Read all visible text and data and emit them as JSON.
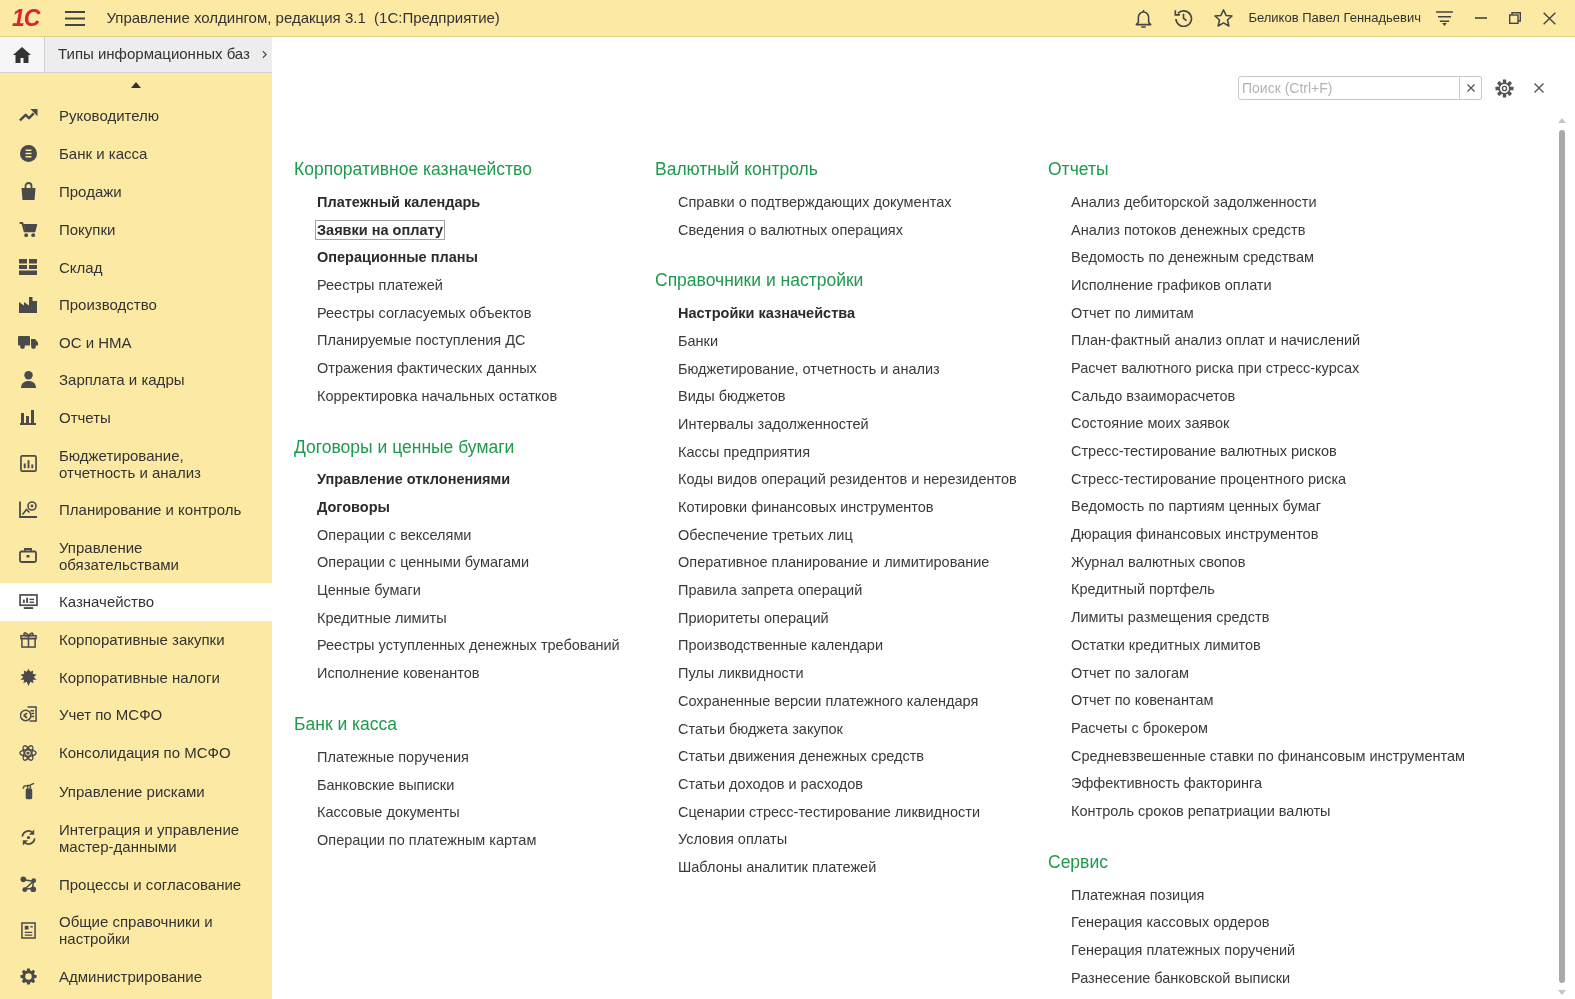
{
  "window": {
    "logo": "1С",
    "title": "Управление холдингом, редакция 3.1  (1С:Предприятие)",
    "user": "Беликов Павел Геннадьевич"
  },
  "tabs": [
    {
      "label": "Типы информационных баз"
    }
  ],
  "sidebar": {
    "items": [
      {
        "label": "Руководителю",
        "selected": false
      },
      {
        "label": "Банк и касса",
        "selected": false
      },
      {
        "label": "Продажи",
        "selected": false
      },
      {
        "label": "Покупки",
        "selected": false
      },
      {
        "label": "Склад",
        "selected": false
      },
      {
        "label": "Производство",
        "selected": false
      },
      {
        "label": "ОС и НМА",
        "selected": false
      },
      {
        "label": "Зарплата и кадры",
        "selected": false
      },
      {
        "label": "Отчеты",
        "selected": false
      },
      {
        "label": "Бюджетирование, отчетность и анализ",
        "selected": false
      },
      {
        "label": "Планирование и контроль",
        "selected": false
      },
      {
        "label": "Управление обязательствами",
        "selected": false
      },
      {
        "label": "Казначейство",
        "selected": true
      },
      {
        "label": "Корпоративные закупки",
        "selected": false
      },
      {
        "label": "Корпоративные налоги",
        "selected": false
      },
      {
        "label": "Учет по МСФО",
        "selected": false
      },
      {
        "label": "Консолидация по МСФО",
        "selected": false
      },
      {
        "label": "Управление рисками",
        "selected": false
      },
      {
        "label": "Интеграция и управление мастер-данными",
        "selected": false
      },
      {
        "label": "Процессы и согласование",
        "selected": false
      },
      {
        "label": "Общие справочники и настройки",
        "selected": false
      },
      {
        "label": "Администрирование",
        "selected": false
      }
    ]
  },
  "search": {
    "placeholder": "Поиск (Ctrl+F)"
  },
  "columns": [
    {
      "sections": [
        {
          "title": "Корпоративное казначейство",
          "items": [
            {
              "label": "Платежный календарь",
              "bold": true,
              "focused": false
            },
            {
              "label": "Заявки на оплату",
              "bold": true,
              "focused": true
            },
            {
              "label": "Операционные планы",
              "bold": true,
              "focused": false
            },
            {
              "label": "Реестры платежей",
              "bold": false,
              "focused": false
            },
            {
              "label": "Реестры согласуемых объектов",
              "bold": false,
              "focused": false
            },
            {
              "label": "Планируемые поступления ДС",
              "bold": false,
              "focused": false
            },
            {
              "label": "Отражения фактических данных",
              "bold": false,
              "focused": false
            },
            {
              "label": "Корректировка начальных остатков",
              "bold": false,
              "focused": false
            }
          ]
        },
        {
          "title": "Договоры и ценные бумаги",
          "items": [
            {
              "label": "Управление отклонениями",
              "bold": true,
              "focused": false
            },
            {
              "label": "Договоры",
              "bold": true,
              "focused": false
            },
            {
              "label": "Операции с векселями",
              "bold": false,
              "focused": false
            },
            {
              "label": "Операции с ценными бумагами",
              "bold": false,
              "focused": false
            },
            {
              "label": "Ценные бумаги",
              "bold": false,
              "focused": false
            },
            {
              "label": "Кредитные лимиты",
              "bold": false,
              "focused": false
            },
            {
              "label": "Реестры уступленных денежных требований",
              "bold": false,
              "focused": false
            },
            {
              "label": "Исполнение ковенантов",
              "bold": false,
              "focused": false
            }
          ]
        },
        {
          "title": "Банк и касса",
          "items": [
            {
              "label": "Платежные поручения",
              "bold": false,
              "focused": false
            },
            {
              "label": "Банковские выписки",
              "bold": false,
              "focused": false
            },
            {
              "label": "Кассовые документы",
              "bold": false,
              "focused": false
            },
            {
              "label": "Операции по платежным картам",
              "bold": false,
              "focused": false
            }
          ]
        }
      ]
    },
    {
      "sections": [
        {
          "title": "Валютный контроль",
          "items": [
            {
              "label": "Справки о подтверждающих документах",
              "bold": false,
              "focused": false
            },
            {
              "label": "Сведения о валютных операциях",
              "bold": false,
              "focused": false
            }
          ]
        },
        {
          "title": "Справочники и настройки",
          "items": [
            {
              "label": "Настройки казначейства",
              "bold": true,
              "focused": false
            },
            {
              "label": "Банки",
              "bold": false,
              "focused": false
            },
            {
              "label": "Бюджетирование, отчетность и анализ",
              "bold": false,
              "focused": false
            },
            {
              "label": "Виды бюджетов",
              "bold": false,
              "focused": false
            },
            {
              "label": "Интервалы задолженностей",
              "bold": false,
              "focused": false
            },
            {
              "label": "Кассы предприятия",
              "bold": false,
              "focused": false
            },
            {
              "label": "Коды видов операций резидентов и нерезидентов",
              "bold": false,
              "focused": false
            },
            {
              "label": "Котировки финансовых инструментов",
              "bold": false,
              "focused": false
            },
            {
              "label": "Обеспечение третьих лиц",
              "bold": false,
              "focused": false
            },
            {
              "label": "Оперативное планирование и лимитирование",
              "bold": false,
              "focused": false
            },
            {
              "label": "Правила запрета операций",
              "bold": false,
              "focused": false
            },
            {
              "label": "Приоритеты операций",
              "bold": false,
              "focused": false
            },
            {
              "label": "Производственные календари",
              "bold": false,
              "focused": false
            },
            {
              "label": "Пулы ликвидности",
              "bold": false,
              "focused": false
            },
            {
              "label": "Сохраненные версии платежного календаря",
              "bold": false,
              "focused": false
            },
            {
              "label": "Статьи бюджета закупок",
              "bold": false,
              "focused": false
            },
            {
              "label": "Статьи движения денежных средств",
              "bold": false,
              "focused": false
            },
            {
              "label": "Статьи доходов и расходов",
              "bold": false,
              "focused": false
            },
            {
              "label": "Сценарии стресс-тестирование ликвидности",
              "bold": false,
              "focused": false
            },
            {
              "label": "Условия оплаты",
              "bold": false,
              "focused": false
            },
            {
              "label": "Шаблоны аналитик платежей",
              "bold": false,
              "focused": false
            }
          ]
        }
      ]
    },
    {
      "sections": [
        {
          "title": "Отчеты",
          "items": [
            {
              "label": "Анализ дебиторской задолженности",
              "bold": false,
              "focused": false
            },
            {
              "label": "Анализ потоков денежных средств",
              "bold": false,
              "focused": false
            },
            {
              "label": "Ведомость по денежным средствам",
              "bold": false,
              "focused": false
            },
            {
              "label": "Исполнение графиков оплати",
              "bold": false,
              "focused": false
            },
            {
              "label": "Отчет по лимитам",
              "bold": false,
              "focused": false
            },
            {
              "label": "План-фактный анализ оплат и начислений",
              "bold": false,
              "focused": false
            },
            {
              "label": "Расчет валютного риска при стресс-курсах",
              "bold": false,
              "focused": false
            },
            {
              "label": "Сальдо взаиморасчетов",
              "bold": false,
              "focused": false
            },
            {
              "label": "Состояние моих заявок",
              "bold": false,
              "focused": false
            },
            {
              "label": "Стресс-тестирование валютных рисков",
              "bold": false,
              "focused": false
            },
            {
              "label": "Стресс-тестирование процентного риска",
              "bold": false,
              "focused": false
            },
            {
              "label": "Ведомость по партиям ценных бумаг",
              "bold": false,
              "focused": false
            },
            {
              "label": "Дюрация финансовых инструментов",
              "bold": false,
              "focused": false
            },
            {
              "label": "Журнал валютных свопов",
              "bold": false,
              "focused": false
            },
            {
              "label": "Кредитный портфель",
              "bold": false,
              "focused": false
            },
            {
              "label": "Лимиты размещения средств",
              "bold": false,
              "focused": false
            },
            {
              "label": "Остатки кредитных лимитов",
              "bold": false,
              "focused": false
            },
            {
              "label": "Отчет по залогам",
              "bold": false,
              "focused": false
            },
            {
              "label": "Отчет по ковенантам",
              "bold": false,
              "focused": false
            },
            {
              "label": "Расчеты с брокером",
              "bold": false,
              "focused": false
            },
            {
              "label": "Средневзвешенные ставки по финансовым инструментам",
              "bold": false,
              "focused": false
            },
            {
              "label": "Эффективность факторинга",
              "bold": false,
              "focused": false
            },
            {
              "label": "Контроль сроков репатриации валюты",
              "bold": false,
              "focused": false
            }
          ]
        },
        {
          "title": "Сервис",
          "items": [
            {
              "label": "Платежная позиция",
              "bold": false,
              "focused": false
            },
            {
              "label": "Генерация кассовых ордеров",
              "bold": false,
              "focused": false
            },
            {
              "label": "Генерация платежных поручений",
              "bold": false,
              "focused": false
            },
            {
              "label": "Разнесение банковской выписки",
              "bold": false,
              "focused": false
            }
          ]
        }
      ]
    }
  ]
}
